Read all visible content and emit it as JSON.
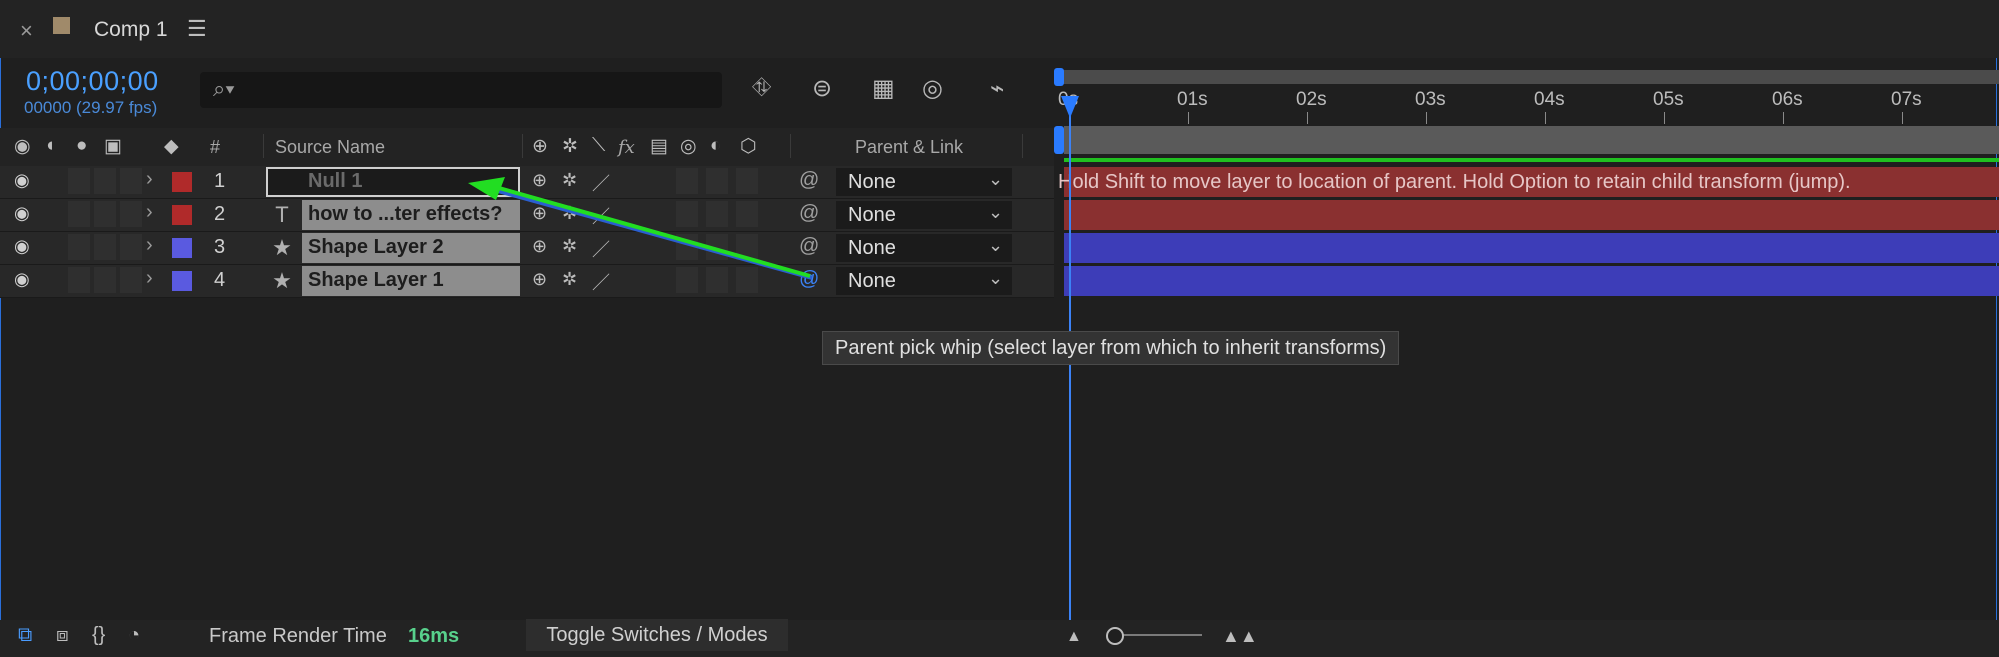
{
  "tab": {
    "close": "×",
    "title": "Comp 1",
    "menu": "☰",
    "swatch_color": "#a08a6a"
  },
  "time": {
    "timecode": "0;00;00;00",
    "frames": "00000 (29.97 fps)"
  },
  "search": {
    "placeholder": "",
    "icon": "search-icon"
  },
  "toolbar_icons": [
    "composition-flowchart-icon",
    "draft-3d-icon",
    "frame-blending-icon",
    "motion-blur-icon",
    "graph-editor-icon"
  ],
  "columns": {
    "number": "#",
    "source_name": "Source Name",
    "parent_link": "Parent & Link",
    "fx": "fx"
  },
  "layers": [
    {
      "num": "1",
      "name": "Null 1",
      "type": "null",
      "type_icon": "■",
      "label_color": "#b02a2a",
      "parent": "None",
      "selected": true
    },
    {
      "num": "2",
      "name": "how to ...ter effects?",
      "type": "text",
      "type_icon": "T",
      "label_color": "#b02a2a",
      "parent": "None",
      "selected": false
    },
    {
      "num": "3",
      "name": "Shape Layer 2",
      "type": "shape",
      "type_icon": "★",
      "label_color": "#5a5ae0",
      "parent": "None",
      "selected": false
    },
    {
      "num": "4",
      "name": "Shape Layer 1",
      "type": "shape",
      "type_icon": "★",
      "label_color": "#5a5ae0",
      "parent": "None",
      "selected": false
    }
  ],
  "timeline": {
    "ruler": [
      "0s",
      "01s",
      "02s",
      "03s",
      "04s",
      "05s",
      "06s",
      "07s"
    ],
    "hint": "Hold Shift to move layer to location of parent. Hold Option to retain child transform (jump).",
    "bar_colors": [
      "#8a3030",
      "#8a3030",
      "#3d3db8",
      "#3d3db8"
    ]
  },
  "tooltip": "Parent pick whip (select layer from which to inherit transforms)",
  "bottom": {
    "frame_render_label": "Frame Render Time",
    "frame_render_value": "16ms",
    "toggle_label": "Toggle Switches / Modes"
  }
}
